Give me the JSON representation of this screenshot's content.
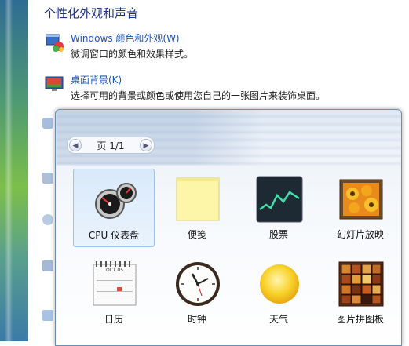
{
  "control_panel": {
    "section_title": "个性化外观和声音",
    "items": [
      {
        "link": "Windows 颜色和外观(W)",
        "description": "微调窗口的颜色和效果样式。"
      },
      {
        "link": "桌面背景(K)",
        "description": "选择可用的背景或颜色或使用您自己的一张图片来装饰桌面。"
      }
    ]
  },
  "gallery": {
    "pager": {
      "prev_icon": "chevron-left-icon",
      "label": "页 1/1",
      "next_icon": "chevron-right-icon"
    },
    "gadgets": [
      {
        "name": "CPU 仪表盘",
        "icon": "cpu-meter-icon",
        "selected": true
      },
      {
        "name": "便笺",
        "icon": "sticky-note-icon"
      },
      {
        "name": "股票",
        "icon": "stocks-icon"
      },
      {
        "name": "幻灯片放映",
        "icon": "slideshow-icon"
      },
      {
        "name": "日历",
        "icon": "calendar-icon",
        "calendar_month": "OCT 05"
      },
      {
        "name": "时钟",
        "icon": "clock-icon"
      },
      {
        "name": "天气",
        "icon": "weather-icon"
      },
      {
        "name": "图片拼图板",
        "icon": "picture-puzzle-icon"
      }
    ]
  }
}
